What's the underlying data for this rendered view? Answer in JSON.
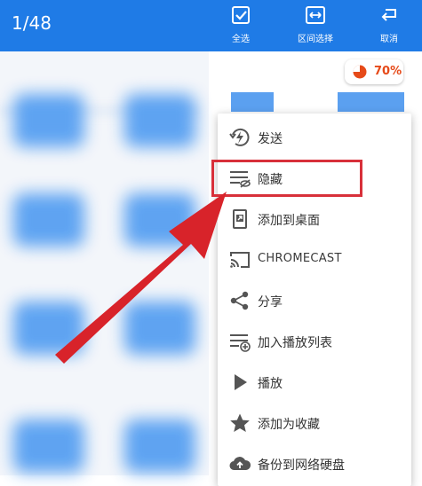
{
  "topbar": {
    "counter": "1/48",
    "actions": {
      "select_all": "全选",
      "range_select": "区间选择",
      "cancel": "取消"
    }
  },
  "storage": {
    "percent_label": "70%",
    "percent": 70,
    "color": "#e64a19"
  },
  "menu": {
    "items": [
      {
        "label": "发送",
        "icon": "lightning-send-icon"
      },
      {
        "label": "隐藏",
        "icon": "hide-list-icon"
      },
      {
        "label": "添加到桌面",
        "icon": "add-to-desktop-icon"
      },
      {
        "label": "CHROMECAST",
        "icon": "cast-icon"
      },
      {
        "label": "分享",
        "icon": "share-icon"
      },
      {
        "label": "加入播放列表",
        "icon": "add-to-playlist-icon"
      },
      {
        "label": "播放",
        "icon": "play-icon"
      },
      {
        "label": "添加为收藏",
        "icon": "star-icon"
      },
      {
        "label": "备份到网络硬盘",
        "icon": "cloud-upload-icon"
      }
    ]
  },
  "colors": {
    "primary": "#1f7be6",
    "highlight": "#d8303a",
    "icon_gray": "#555555"
  }
}
